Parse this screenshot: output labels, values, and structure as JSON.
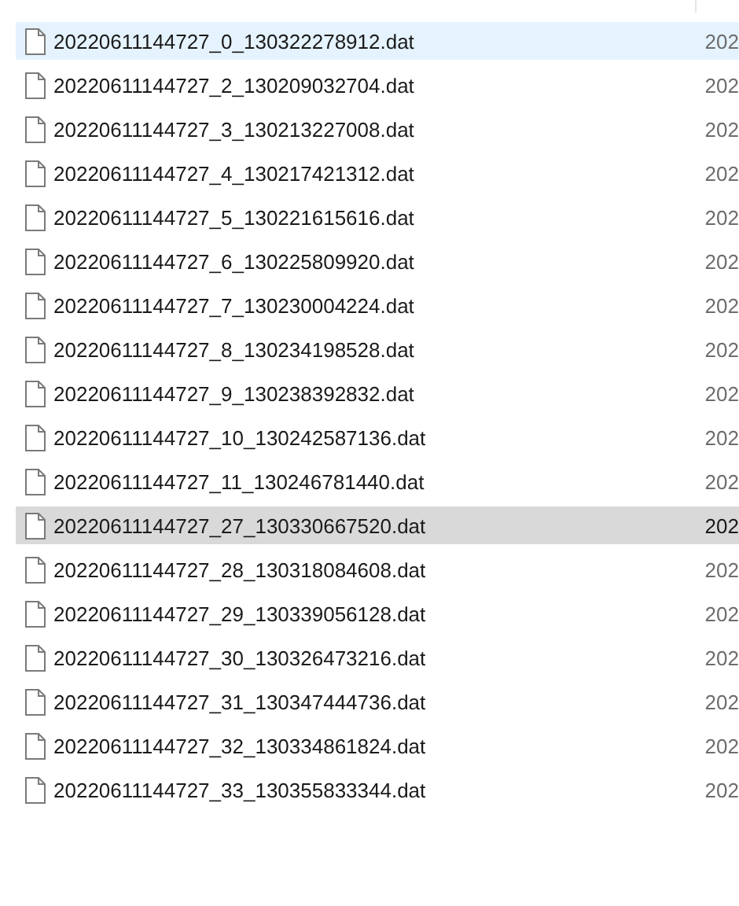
{
  "files": [
    {
      "name": "20220611144727_0_130322278912.dat",
      "date": "202",
      "selected": false,
      "hovered": true
    },
    {
      "name": "20220611144727_2_130209032704.dat",
      "date": "202",
      "selected": false,
      "hovered": false
    },
    {
      "name": "20220611144727_3_130213227008.dat",
      "date": "202",
      "selected": false,
      "hovered": false
    },
    {
      "name": "20220611144727_4_130217421312.dat",
      "date": "202",
      "selected": false,
      "hovered": false
    },
    {
      "name": "20220611144727_5_130221615616.dat",
      "date": "202",
      "selected": false,
      "hovered": false
    },
    {
      "name": "20220611144727_6_130225809920.dat",
      "date": "202",
      "selected": false,
      "hovered": false
    },
    {
      "name": "20220611144727_7_130230004224.dat",
      "date": "202",
      "selected": false,
      "hovered": false
    },
    {
      "name": "20220611144727_8_130234198528.dat",
      "date": "202",
      "selected": false,
      "hovered": false
    },
    {
      "name": "20220611144727_9_130238392832.dat",
      "date": "202",
      "selected": false,
      "hovered": false
    },
    {
      "name": "20220611144727_10_130242587136.dat",
      "date": "202",
      "selected": false,
      "hovered": false
    },
    {
      "name": "20220611144727_11_130246781440.dat",
      "date": "202",
      "selected": false,
      "hovered": false
    },
    {
      "name": "20220611144727_27_130330667520.dat",
      "date": "202",
      "selected": true,
      "hovered": false
    },
    {
      "name": "20220611144727_28_130318084608.dat",
      "date": "202",
      "selected": false,
      "hovered": false
    },
    {
      "name": "20220611144727_29_130339056128.dat",
      "date": "202",
      "selected": false,
      "hovered": false
    },
    {
      "name": "20220611144727_30_130326473216.dat",
      "date": "202",
      "selected": false,
      "hovered": false
    },
    {
      "name": "20220611144727_31_130347444736.dat",
      "date": "202",
      "selected": false,
      "hovered": false
    },
    {
      "name": "20220611144727_32_130334861824.dat",
      "date": "202",
      "selected": false,
      "hovered": false
    },
    {
      "name": "20220611144727_33_130355833344.dat",
      "date": "202",
      "selected": false,
      "hovered": false
    }
  ]
}
